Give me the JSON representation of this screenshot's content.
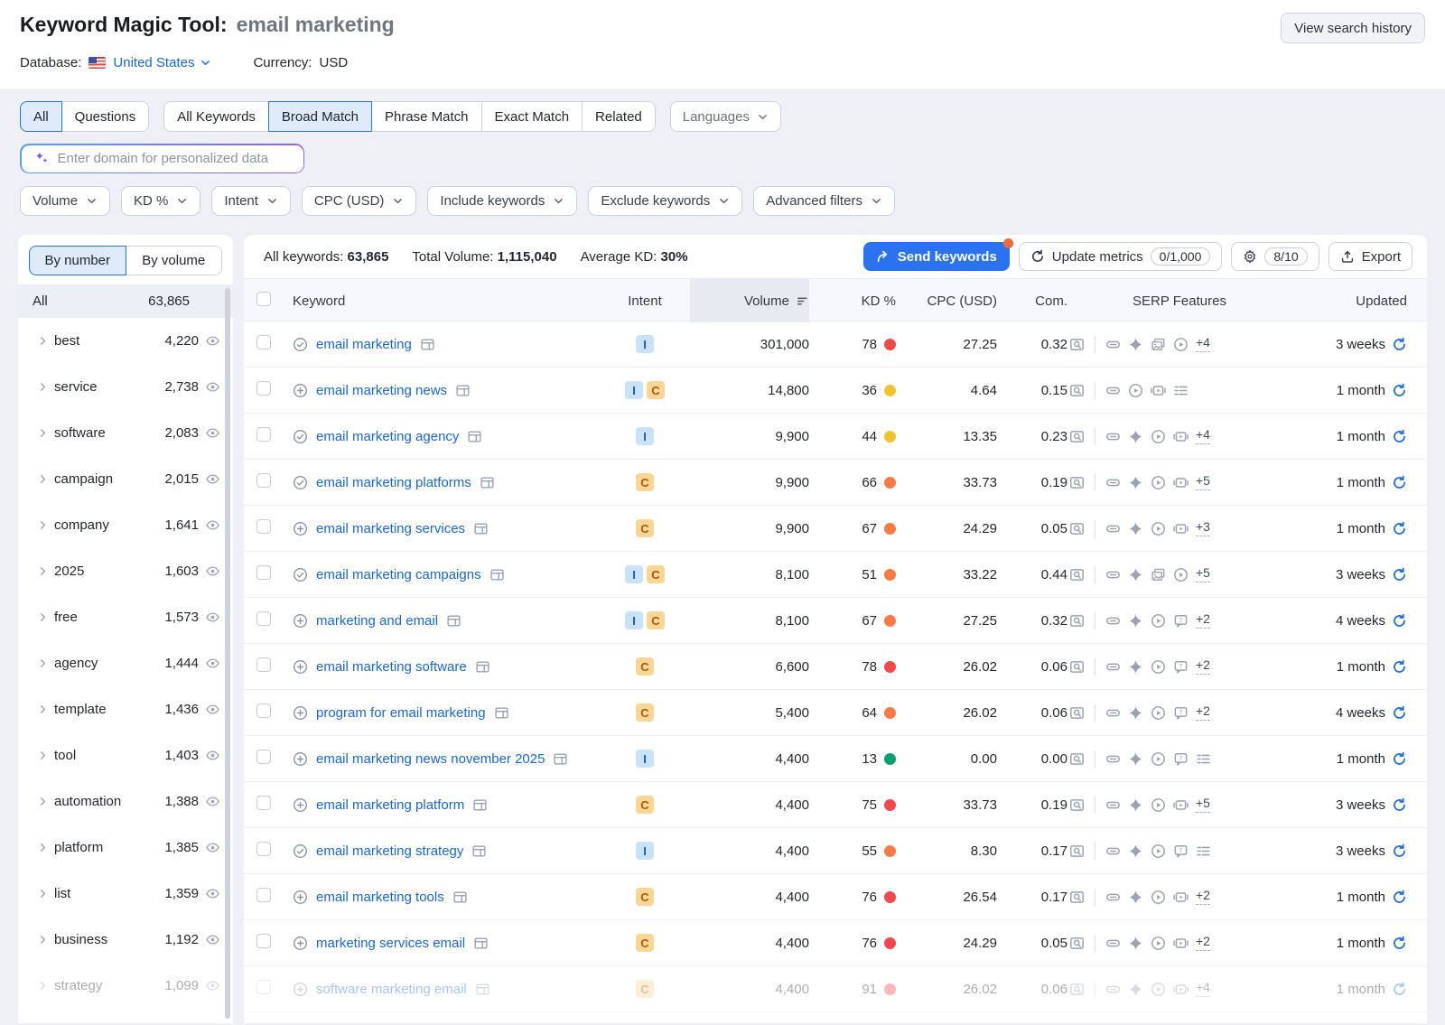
{
  "header": {
    "title": "Keyword Magic Tool:",
    "query": "email marketing",
    "database_label": "Database:",
    "database_value": "United States",
    "currency_label": "Currency:",
    "currency_value": "USD",
    "view_history_label": "View search history"
  },
  "tabs": {
    "groups": [
      [
        {
          "label": "All",
          "selected": true
        },
        {
          "label": "Questions",
          "selected": false
        }
      ],
      [
        {
          "label": "All Keywords",
          "selected": false
        },
        {
          "label": "Broad Match",
          "selected": true
        },
        {
          "label": "Phrase Match",
          "selected": false
        },
        {
          "label": "Exact Match",
          "selected": false
        },
        {
          "label": "Related",
          "selected": false
        }
      ]
    ],
    "languages_label": "Languages"
  },
  "domain_input": {
    "placeholder": "Enter domain for personalized data"
  },
  "filters": [
    "Volume",
    "KD %",
    "Intent",
    "CPC (USD)",
    "Include keywords",
    "Exclude keywords",
    "Advanced filters"
  ],
  "sidebar": {
    "toggle": [
      {
        "label": "By number",
        "selected": true
      },
      {
        "label": "By volume",
        "selected": false
      }
    ],
    "all_label": "All",
    "all_count": "63,865",
    "groups": [
      {
        "label": "best",
        "count": "4,220",
        "faded": false
      },
      {
        "label": "service",
        "count": "2,738",
        "faded": false
      },
      {
        "label": "software",
        "count": "2,083",
        "faded": false
      },
      {
        "label": "campaign",
        "count": "2,015",
        "faded": false
      },
      {
        "label": "company",
        "count": "1,641",
        "faded": false
      },
      {
        "label": "2025",
        "count": "1,603",
        "faded": false
      },
      {
        "label": "free",
        "count": "1,573",
        "faded": false
      },
      {
        "label": "agency",
        "count": "1,444",
        "faded": false
      },
      {
        "label": "template",
        "count": "1,436",
        "faded": false
      },
      {
        "label": "tool",
        "count": "1,403",
        "faded": false
      },
      {
        "label": "automation",
        "count": "1,388",
        "faded": false
      },
      {
        "label": "platform",
        "count": "1,385",
        "faded": false
      },
      {
        "label": "list",
        "count": "1,359",
        "faded": false
      },
      {
        "label": "business",
        "count": "1,192",
        "faded": false
      },
      {
        "label": "strategy",
        "count": "1,099",
        "faded": true
      }
    ]
  },
  "stats": {
    "all_keywords_label": "All keywords:",
    "all_keywords_value": "63,865",
    "total_volume_label": "Total Volume:",
    "total_volume_value": "1,115,040",
    "average_kd_label": "Average KD:",
    "average_kd_value": "30%"
  },
  "actions": {
    "send_keywords_label": "Send keywords",
    "update_metrics_label": "Update metrics",
    "update_metrics_quota": "0/1,000",
    "gear_quota": "8/10",
    "export_label": "Export"
  },
  "table": {
    "columns": [
      "Keyword",
      "Intent",
      "Volume",
      "KD %",
      "CPC (USD)",
      "Com.",
      "SERP Features",
      "Updated"
    ],
    "rows": [
      {
        "keyword": "email marketing",
        "in_list": true,
        "intent": [
          "I"
        ],
        "volume": "301,000",
        "kd": "78",
        "kd_level": "red",
        "cpc": "27.25",
        "com": "0.32",
        "serp": [
          "sitelinks",
          "ai-overview",
          "image-pack",
          "video"
        ],
        "serp_more": "+4",
        "updated": "3 weeks",
        "faded": false
      },
      {
        "keyword": "email marketing news",
        "in_list": false,
        "intent": [
          "I",
          "C"
        ],
        "volume": "14,800",
        "kd": "36",
        "kd_level": "yellow",
        "cpc": "4.64",
        "com": "0.15",
        "serp": [
          "sitelinks",
          "video",
          "video-carousel",
          "related-searches"
        ],
        "serp_more": "",
        "updated": "1 month",
        "faded": false
      },
      {
        "keyword": "email marketing agency",
        "in_list": true,
        "intent": [
          "I"
        ],
        "volume": "9,900",
        "kd": "44",
        "kd_level": "yellow",
        "cpc": "13.35",
        "com": "0.23",
        "serp": [
          "sitelinks",
          "ai-overview",
          "video",
          "video-carousel"
        ],
        "serp_more": "+4",
        "updated": "1 month",
        "faded": false
      },
      {
        "keyword": "email marketing platforms",
        "in_list": true,
        "intent": [
          "C"
        ],
        "volume": "9,900",
        "kd": "66",
        "kd_level": "orange",
        "cpc": "33.73",
        "com": "0.19",
        "serp": [
          "sitelinks",
          "ai-overview",
          "video",
          "video-carousel"
        ],
        "serp_more": "+5",
        "updated": "1 month",
        "faded": false
      },
      {
        "keyword": "email marketing services",
        "in_list": false,
        "intent": [
          "C"
        ],
        "volume": "9,900",
        "kd": "67",
        "kd_level": "orange",
        "cpc": "24.29",
        "com": "0.05",
        "serp": [
          "sitelinks",
          "ai-overview",
          "video",
          "video-carousel"
        ],
        "serp_more": "+3",
        "updated": "1 month",
        "faded": false
      },
      {
        "keyword": "email marketing campaigns",
        "in_list": true,
        "intent": [
          "I",
          "C"
        ],
        "volume": "8,100",
        "kd": "51",
        "kd_level": "orange",
        "cpc": "33.22",
        "com": "0.44",
        "serp": [
          "sitelinks",
          "ai-overview",
          "image-pack",
          "video"
        ],
        "serp_more": "+5",
        "updated": "3 weeks",
        "faded": false
      },
      {
        "keyword": "marketing and email",
        "in_list": false,
        "intent": [
          "I",
          "C"
        ],
        "volume": "8,100",
        "kd": "67",
        "kd_level": "orange",
        "cpc": "27.25",
        "com": "0.32",
        "serp": [
          "sitelinks",
          "ai-overview",
          "video",
          "people-also-ask"
        ],
        "serp_more": "+2",
        "updated": "4 weeks",
        "faded": false
      },
      {
        "keyword": "email marketing software",
        "in_list": false,
        "intent": [
          "C"
        ],
        "volume": "6,600",
        "kd": "78",
        "kd_level": "red",
        "cpc": "26.02",
        "com": "0.06",
        "serp": [
          "sitelinks",
          "ai-overview",
          "video",
          "people-also-ask"
        ],
        "serp_more": "+2",
        "updated": "1 month",
        "faded": false
      },
      {
        "keyword": "program for email marketing",
        "in_list": false,
        "intent": [
          "C"
        ],
        "volume": "5,400",
        "kd": "64",
        "kd_level": "orange",
        "cpc": "26.02",
        "com": "0.06",
        "serp": [
          "sitelinks",
          "ai-overview",
          "video",
          "people-also-ask"
        ],
        "serp_more": "+2",
        "updated": "4 weeks",
        "faded": false
      },
      {
        "keyword": "email marketing news november 2025",
        "in_list": false,
        "intent": [
          "I"
        ],
        "volume": "4,400",
        "kd": "13",
        "kd_level": "green",
        "cpc": "0.00",
        "com": "0.00",
        "serp": [
          "sitelinks",
          "ai-overview",
          "video",
          "people-also-ask",
          "related-searches"
        ],
        "serp_more": "",
        "updated": "1 month",
        "faded": false
      },
      {
        "keyword": "email marketing platform",
        "in_list": false,
        "intent": [
          "C"
        ],
        "volume": "4,400",
        "kd": "75",
        "kd_level": "red",
        "cpc": "33.73",
        "com": "0.19",
        "serp": [
          "sitelinks",
          "ai-overview",
          "video",
          "video-carousel"
        ],
        "serp_more": "+5",
        "updated": "3 weeks",
        "faded": false
      },
      {
        "keyword": "email marketing strategy",
        "in_list": true,
        "intent": [
          "I"
        ],
        "volume": "4,400",
        "kd": "55",
        "kd_level": "orange",
        "cpc": "8.30",
        "com": "0.17",
        "serp": [
          "sitelinks",
          "ai-overview",
          "video",
          "people-also-ask",
          "related-searches"
        ],
        "serp_more": "",
        "updated": "3 weeks",
        "faded": false
      },
      {
        "keyword": "email marketing tools",
        "in_list": false,
        "intent": [
          "C"
        ],
        "volume": "4,400",
        "kd": "76",
        "kd_level": "red",
        "cpc": "26.54",
        "com": "0.17",
        "serp": [
          "sitelinks",
          "ai-overview",
          "video",
          "video-carousel"
        ],
        "serp_more": "+2",
        "updated": "1 month",
        "faded": false
      },
      {
        "keyword": "marketing services email",
        "in_list": false,
        "intent": [
          "C"
        ],
        "volume": "4,400",
        "kd": "76",
        "kd_level": "red",
        "cpc": "24.29",
        "com": "0.05",
        "serp": [
          "sitelinks",
          "ai-overview",
          "video",
          "video-carousel"
        ],
        "serp_more": "+2",
        "updated": "1 month",
        "faded": false
      },
      {
        "keyword": "software marketing email",
        "in_list": false,
        "intent": [
          "C"
        ],
        "volume": "4,400",
        "kd": "91",
        "kd_level": "red",
        "cpc": "26.02",
        "com": "0.06",
        "serp": [
          "sitelinks",
          "ai-overview",
          "video",
          "video-carousel"
        ],
        "serp_more": "+4",
        "updated": "1 month",
        "faded": true
      }
    ]
  },
  "colors": {
    "accent_blue": "#2b72f0",
    "kd_green": "#00a071",
    "kd_yellow": "#f0c330",
    "kd_orange": "#ff7a43",
    "kd_red": "#f4484d",
    "notification_dot": "#f2673c"
  }
}
